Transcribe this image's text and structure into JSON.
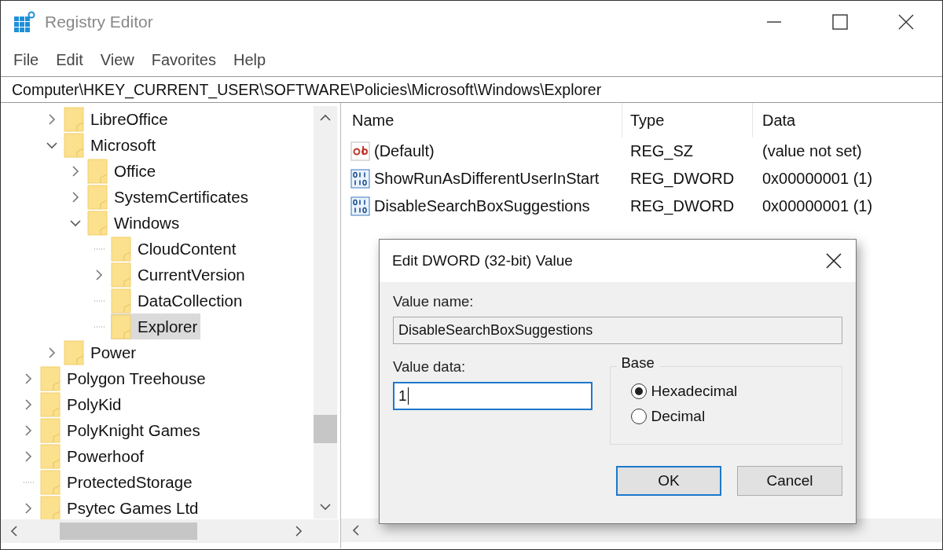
{
  "window": {
    "title": "Registry Editor"
  },
  "menu": [
    {
      "label": "File"
    },
    {
      "label": "Edit"
    },
    {
      "label": "View"
    },
    {
      "label": "Favorites"
    },
    {
      "label": "Help"
    }
  ],
  "address": "Computer\\HKEY_CURRENT_USER\\SOFTWARE\\Policies\\Microsoft\\Windows\\Explorer",
  "tree": {
    "branch": [
      {
        "label": "LibreOffice",
        "expandable": true,
        "expanded": false,
        "selected": false
      },
      {
        "label": "Microsoft",
        "expandable": true,
        "expanded": true,
        "selected": false,
        "children": [
          {
            "label": "Office",
            "expandable": true,
            "expanded": false,
            "selected": false
          },
          {
            "label": "SystemCertificates",
            "expandable": true,
            "expanded": false,
            "selected": false
          },
          {
            "label": "Windows",
            "expandable": true,
            "expanded": true,
            "selected": false,
            "children": [
              {
                "label": "CloudContent",
                "expandable": false,
                "selected": false
              },
              {
                "label": "CurrentVersion",
                "expandable": true,
                "expanded": false,
                "selected": false
              },
              {
                "label": "DataCollection",
                "expandable": false,
                "selected": false
              },
              {
                "label": "Explorer",
                "expandable": false,
                "selected": true
              }
            ]
          }
        ]
      },
      {
        "label": "Power",
        "expandable": true,
        "expanded": false,
        "selected": false
      }
    ],
    "items": [
      {
        "label": "Polygon Treehouse",
        "expandable": true,
        "expanded": false,
        "selected": false
      },
      {
        "label": "PolyKid",
        "expandable": true,
        "expanded": false,
        "selected": false
      },
      {
        "label": "PolyKnight Games",
        "expandable": true,
        "expanded": false,
        "selected": false
      },
      {
        "label": "Powerhoof",
        "expandable": true,
        "expanded": false,
        "selected": false
      },
      {
        "label": "ProtectedStorage",
        "expandable": false,
        "selected": false
      },
      {
        "label": "Psytec Games Ltd",
        "expandable": true,
        "expanded": false,
        "selected": false
      }
    ]
  },
  "values": {
    "columns": [
      "Name",
      "Type",
      "Data"
    ],
    "rows": [
      {
        "kind": "string",
        "name": "(Default)",
        "type": "REG_SZ",
        "data": "(value not set)"
      },
      {
        "kind": "binary",
        "name": "ShowRunAsDifferentUserInStart",
        "type": "REG_DWORD",
        "data": "0x00000001 (1)"
      },
      {
        "kind": "binary",
        "name": "DisableSearchBoxSuggestions",
        "type": "REG_DWORD",
        "data": "0x00000001 (1)"
      }
    ]
  },
  "dialog": {
    "title": "Edit DWORD (32-bit) Value",
    "value_name_label": "Value name:",
    "value_name": "DisableSearchBoxSuggestions",
    "value_data_label": "Value data:",
    "value_data": "1",
    "base_label": "Base",
    "base_options": [
      {
        "label": "Hexadecimal",
        "selected": true
      },
      {
        "label": "Decimal",
        "selected": false
      }
    ],
    "buttons": [
      {
        "label": "OK",
        "default": true
      },
      {
        "label": "Cancel",
        "default": false
      }
    ]
  }
}
